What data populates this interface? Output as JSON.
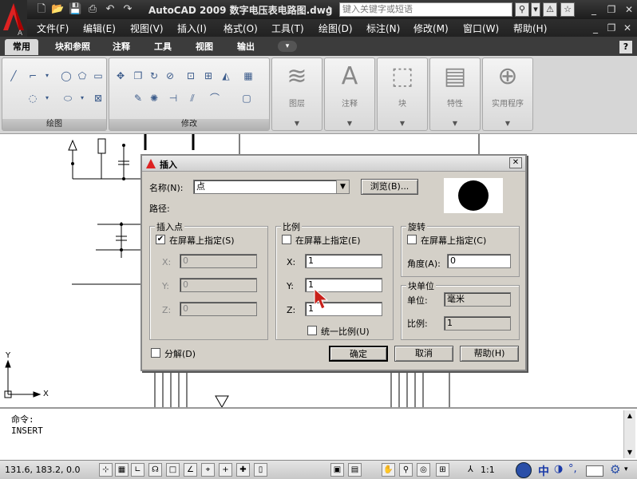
{
  "app": {
    "title": "AutoCAD 2009 数字电压表电路图.dwg",
    "search_placeholder": "键入关键字或短语",
    "logo_letter": "A"
  },
  "menu": [
    "文件(F)",
    "编辑(E)",
    "视图(V)",
    "插入(I)",
    "格式(O)",
    "工具(T)",
    "绘图(D)",
    "标注(N)",
    "修改(M)",
    "窗口(W)",
    "帮助(H)"
  ],
  "tabs": [
    "常用",
    "块和参照",
    "注释",
    "工具",
    "视图",
    "输出"
  ],
  "ribbon": {
    "draw_label": "绘图",
    "modify_label": "修改",
    "layers_label": "图层",
    "annotation_label": "注释",
    "block_label": "块",
    "properties_label": "特性",
    "utilities_label": "实用程序"
  },
  "dialog": {
    "title": "插入",
    "name_label": "名称(N):",
    "name_value": "点",
    "browse_label": "浏览(B)...",
    "path_label": "路径:",
    "insertion": {
      "title": "插入点",
      "specify_label": "在屏幕上指定(S)",
      "specify_checked": true,
      "x_label": "X:",
      "y_label": "Y:",
      "z_label": "Z:",
      "x": "0",
      "y": "0",
      "z": "0"
    },
    "scale": {
      "title": "比例",
      "specify_label": "在屏幕上指定(E)",
      "specify_checked": false,
      "x_label": "X:",
      "y_label": "Y:",
      "z_label": "Z:",
      "x": "1",
      "y": "1",
      "z": "1",
      "uniform_label": "统一比例(U)",
      "uniform_checked": false
    },
    "rotation": {
      "title": "旋转",
      "specify_label": "在屏幕上指定(C)",
      "specify_checked": false,
      "angle_label": "角度(A):",
      "angle": "0"
    },
    "block_unit": {
      "title": "块单位",
      "unit_label": "单位:",
      "unit_value": "毫米",
      "factor_label": "比例:",
      "factor_value": "1"
    },
    "explode_label": "分解(D)",
    "explode_checked": false,
    "ok_label": "确定",
    "cancel_label": "取消",
    "help_label": "帮助(H)"
  },
  "command": {
    "line1": "命令:",
    "line2": "INSERT"
  },
  "ucs": {
    "x": "X",
    "y": "Y"
  },
  "status": {
    "coords": "131.6, 183.2, 0.0",
    "scale": "1:1",
    "ime_text": "中"
  }
}
